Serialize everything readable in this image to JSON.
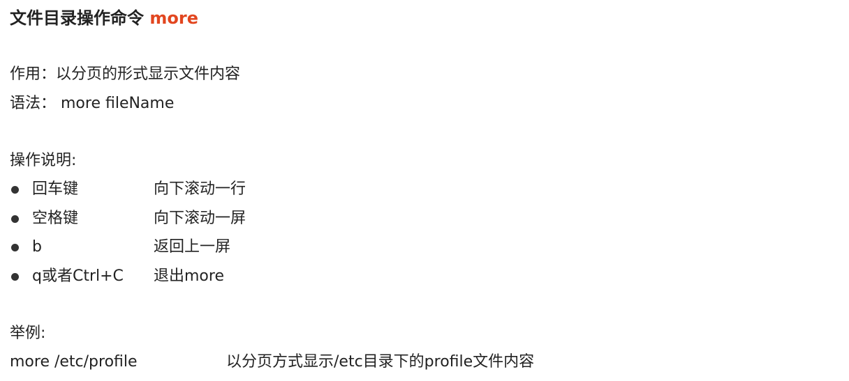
{
  "title": {
    "prefix": "文件目录操作命令 ",
    "command": "more"
  },
  "purpose": "作用：以分页的形式显示文件内容",
  "syntax": "语法： more fileName",
  "operations": {
    "heading": "操作说明:",
    "items": [
      {
        "key": "回车键",
        "desc": "向下滚动一行"
      },
      {
        "key": "空格键",
        "desc": "向下滚动一屏"
      },
      {
        "key": "b",
        "desc": "返回上一屏"
      },
      {
        "key": "q或者Ctrl+C",
        "desc": "退出more"
      }
    ]
  },
  "example": {
    "heading": "举例:",
    "command": "more /etc/profile",
    "desc": "以分页方式显示/etc目录下的profile文件内容"
  },
  "colors": {
    "accent": "#e2461f",
    "text": "#222222"
  }
}
